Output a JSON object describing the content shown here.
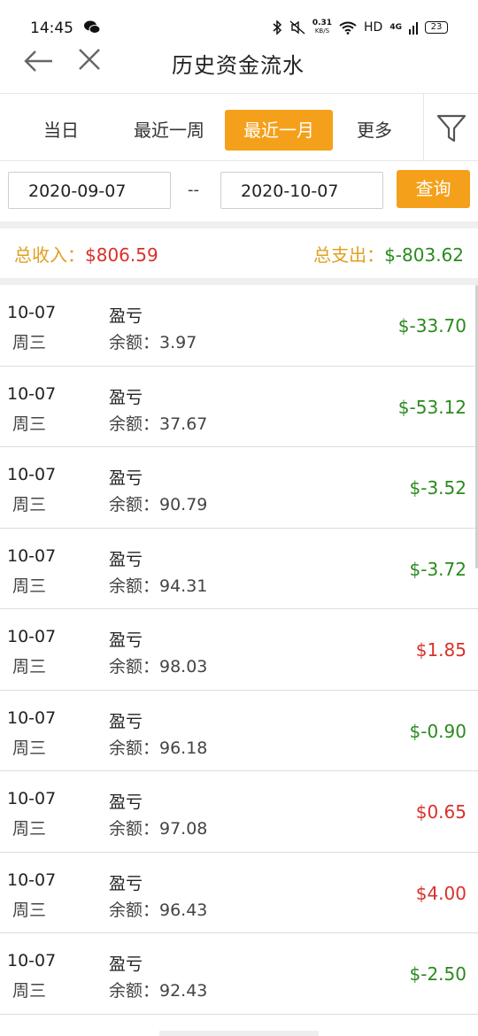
{
  "status_bar": {
    "time": "14:45",
    "speed_top": "0.31",
    "speed_bottom": "KB/S",
    "network": "HD",
    "signal_label": "4G",
    "battery": "23"
  },
  "header": {
    "title": "历史资金流水"
  },
  "tabs": [
    {
      "label": "当日",
      "active": false
    },
    {
      "label": "最近一周",
      "active": false
    },
    {
      "label": "最近一月",
      "active": true
    },
    {
      "label": "更多",
      "active": false
    }
  ],
  "date_filter": {
    "start": "2020-09-07",
    "separator": "--",
    "end": "2020-10-07",
    "query_label": "查询"
  },
  "summary": {
    "income_label": "总收入：",
    "income_value": "$806.59",
    "expense_label": "总支出：",
    "expense_value": "$-803.62"
  },
  "records": [
    {
      "date": "10-07",
      "weekday": "周三",
      "type": "盈亏",
      "balance": "余额：3.97",
      "amount": "$-33.70",
      "sign": "neg"
    },
    {
      "date": "10-07",
      "weekday": "周三",
      "type": "盈亏",
      "balance": "余额：37.67",
      "amount": "$-53.12",
      "sign": "neg"
    },
    {
      "date": "10-07",
      "weekday": "周三",
      "type": "盈亏",
      "balance": "余额：90.79",
      "amount": "$-3.52",
      "sign": "neg"
    },
    {
      "date": "10-07",
      "weekday": "周三",
      "type": "盈亏",
      "balance": "余额：94.31",
      "amount": "$-3.72",
      "sign": "neg"
    },
    {
      "date": "10-07",
      "weekday": "周三",
      "type": "盈亏",
      "balance": "余额：98.03",
      "amount": "$1.85",
      "sign": "pos"
    },
    {
      "date": "10-07",
      "weekday": "周三",
      "type": "盈亏",
      "balance": "余额：96.18",
      "amount": "$-0.90",
      "sign": "neg"
    },
    {
      "date": "10-07",
      "weekday": "周三",
      "type": "盈亏",
      "balance": "余额：97.08",
      "amount": "$0.65",
      "sign": "pos"
    },
    {
      "date": "10-07",
      "weekday": "周三",
      "type": "盈亏",
      "balance": "余额：96.43",
      "amount": "$4.00",
      "sign": "pos"
    },
    {
      "date": "10-07",
      "weekday": "周三",
      "type": "盈亏",
      "balance": "余额：92.43",
      "amount": "$-2.50",
      "sign": "neg"
    }
  ],
  "colors": {
    "accent": "#f5a01a",
    "positive": "#d9302b",
    "negative": "#2a8a1e",
    "label": "#e0a020"
  }
}
